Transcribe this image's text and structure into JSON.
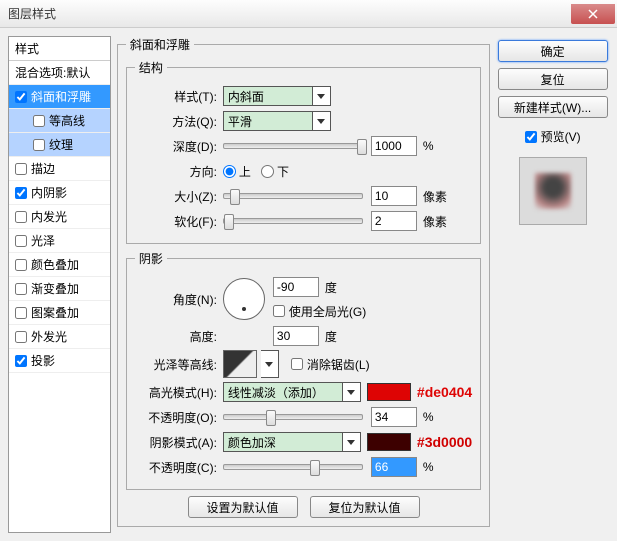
{
  "window": {
    "title": "图层样式",
    "close": "×"
  },
  "left": {
    "header": "样式",
    "blend": "混合选项:默认",
    "items": [
      {
        "label": "斜面和浮雕",
        "checked": true,
        "selected": true,
        "active": true
      },
      {
        "label": "等高线",
        "checked": false,
        "sub": true,
        "selected": true
      },
      {
        "label": "纹理",
        "checked": false,
        "sub": true,
        "selected": true
      },
      {
        "label": "描边",
        "checked": false
      },
      {
        "label": "内阴影",
        "checked": true
      },
      {
        "label": "内发光",
        "checked": false
      },
      {
        "label": "光泽",
        "checked": false
      },
      {
        "label": "颜色叠加",
        "checked": false
      },
      {
        "label": "渐变叠加",
        "checked": false
      },
      {
        "label": "图案叠加",
        "checked": false
      },
      {
        "label": "外发光",
        "checked": false
      },
      {
        "label": "投影",
        "checked": true
      }
    ]
  },
  "center": {
    "groupTitle": "斜面和浮雕",
    "structTitle": "结构",
    "styleLabel": "样式(T):",
    "styleValue": "内斜面",
    "methodLabel": "方法(Q):",
    "methodValue": "平滑",
    "depthLabel": "深度(D):",
    "depthValue": "1000",
    "depthUnit": "%",
    "dirLabel": "方向:",
    "dirUp": "上",
    "dirDown": "下",
    "sizeLabel": "大小(Z):",
    "sizeValue": "10",
    "sizeUnit": "像素",
    "softenLabel": "软化(F):",
    "softenValue": "2",
    "softenUnit": "像素",
    "shadeTitle": "阴影",
    "angleLabel": "角度(N):",
    "angleValue": "-90",
    "angleUnit": "度",
    "globalLight": "使用全局光(G)",
    "altLabel": "高度:",
    "altValue": "30",
    "altUnit": "度",
    "glossLabel": "光泽等高线:",
    "antiAlias": "消除锯齿(L)",
    "hiLabel": "高光模式(H):",
    "hiValue": "线性减淡（添加）",
    "hiColor": "#de0404",
    "hiHex": "#de0404",
    "hiOpLabel": "不透明度(O):",
    "hiOpValue": "34",
    "hiOpUnit": "%",
    "shLabel": "阴影模式(A):",
    "shValue": "颜色加深",
    "shColor": "#3d0000",
    "shHex": "#3d0000",
    "shOpLabel": "不透明度(C):",
    "shOpValue": "66",
    "shOpUnit": "%",
    "defaultBtn": "设置为默认值",
    "resetBtn": "复位为默认值"
  },
  "right": {
    "ok": "确定",
    "cancel": "复位",
    "newStyle": "新建样式(W)...",
    "previewLabel": "预览(V)"
  }
}
